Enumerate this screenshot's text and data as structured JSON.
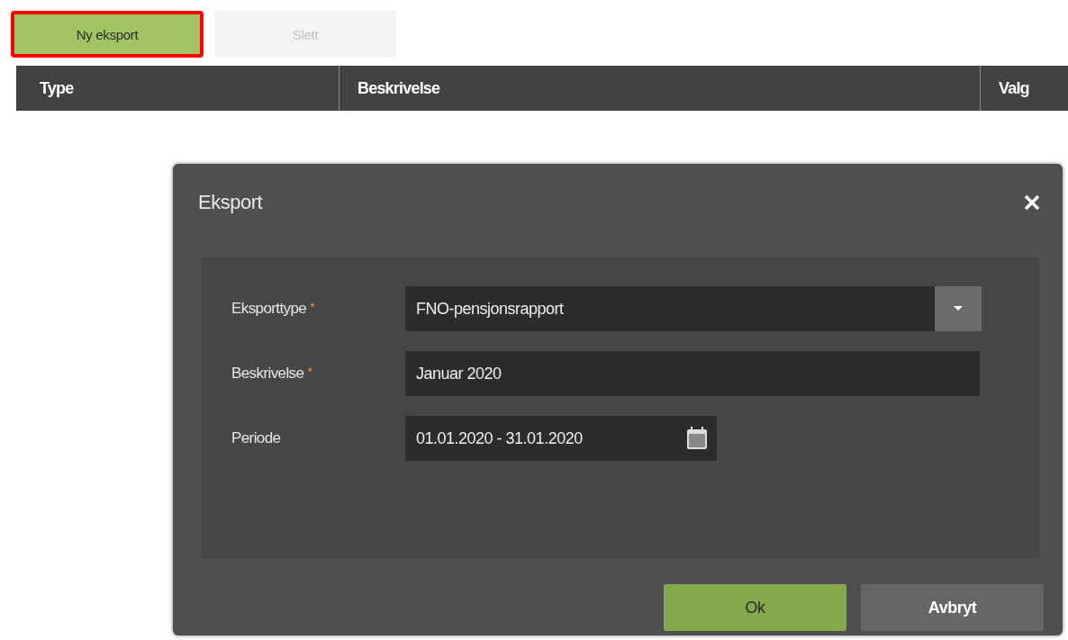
{
  "toolbar": {
    "buttons": [
      {
        "label": "Ny eksport",
        "kind": "primary",
        "highlighted": true,
        "disabled": false
      },
      {
        "label": "Slett",
        "kind": "secondary",
        "highlighted": false,
        "disabled": true
      }
    ]
  },
  "table": {
    "columns": [
      "Type",
      "Beskrivelse",
      "Valg"
    ]
  },
  "dialog": {
    "title": "Eksport",
    "fields": [
      {
        "label": "Eksporttype",
        "required_mark": "*",
        "kind": "dropdown",
        "value": "FNO-pensjonsrapport"
      },
      {
        "label": "Beskrivelse",
        "required_mark": "*",
        "kind": "text",
        "value": "Januar 2020"
      },
      {
        "label": "Periode",
        "kind": "daterange",
        "value": "01.01.2020 - 31.01.2020"
      }
    ],
    "buttons": [
      {
        "label": "Ok",
        "kind": "primary"
      },
      {
        "label": "Avbryt",
        "kind": "secondary"
      }
    ]
  }
}
